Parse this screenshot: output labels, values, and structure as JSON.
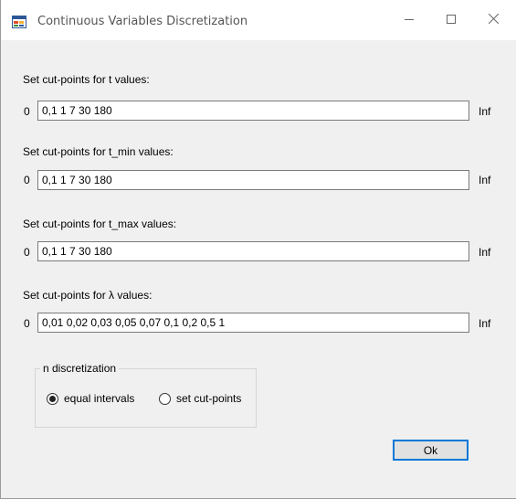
{
  "window": {
    "title": "Continuous Variables Discretization",
    "icons": {
      "app": "app-icon",
      "minimize": "minimize-icon",
      "maximize": "maximize-icon",
      "close": "close-icon"
    }
  },
  "rows": [
    {
      "label": "Set cut-points for t values:",
      "lower": "0",
      "value": "0,1 1 7 30 180",
      "upper": "Inf"
    },
    {
      "label": "Set cut-points for t_min values:",
      "lower": "0",
      "value": "0,1 1 7 30 180",
      "upper": "Inf"
    },
    {
      "label": "Set cut-points for t_max values:",
      "lower": "0",
      "value": "0,1 1 7 30 180",
      "upper": "Inf"
    },
    {
      "label": "Set cut-points for λ values:",
      "lower": "0",
      "value": "0,01 0,02 0,03 0,05 0,07 0,1 0,2 0,5 1",
      "upper": "Inf"
    }
  ],
  "discretization": {
    "legend": "n discretization",
    "options": [
      {
        "label": "equal intervals",
        "checked": true
      },
      {
        "label": "set cut-points",
        "checked": false
      }
    ]
  },
  "buttons": {
    "ok": "Ok"
  },
  "colors": {
    "window_bg": "#f0f0f0",
    "titlebar_bg": "#ffffff",
    "accent": "#0078d7"
  }
}
